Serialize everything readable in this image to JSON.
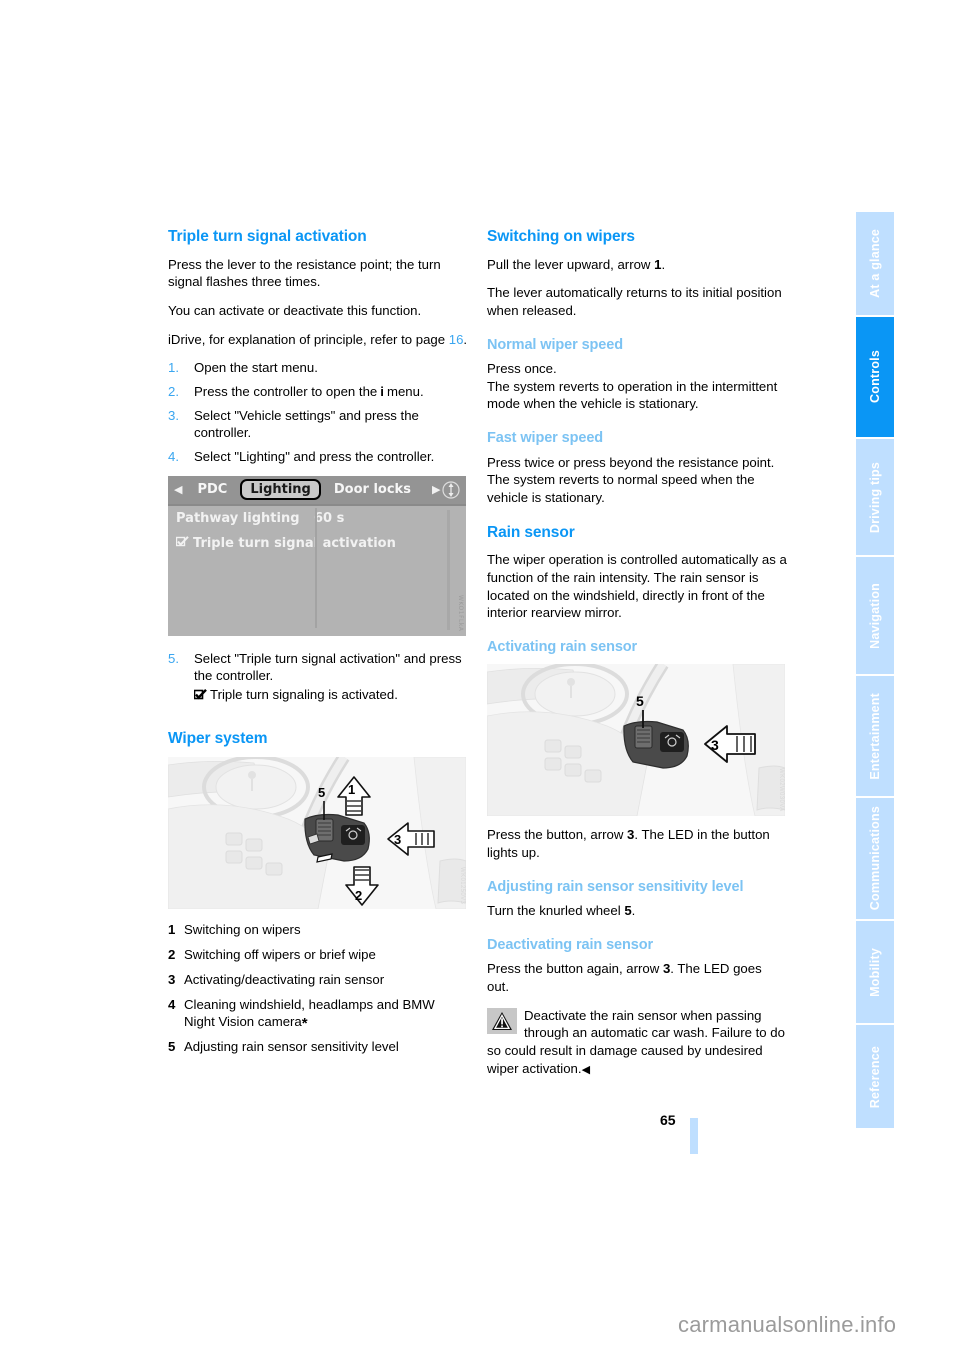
{
  "page": {
    "number": "65",
    "watermark": "carmanualsonline.info"
  },
  "sidebar": {
    "tabs": [
      {
        "label": "At a glance",
        "active": false
      },
      {
        "label": "Controls",
        "active": true
      },
      {
        "label": "Driving tips",
        "active": false
      },
      {
        "label": "Navigation",
        "active": false
      },
      {
        "label": "Entertainment",
        "active": false
      },
      {
        "label": "Communications",
        "active": false
      },
      {
        "label": "Mobility",
        "active": false
      },
      {
        "label": "Reference",
        "active": false
      }
    ],
    "active_color": "#0a96f5",
    "inactive_color": "#bfdfff"
  },
  "colors": {
    "heading": "#0a96f5",
    "subheading": "#7cc3f3",
    "link": "#3aa6f0"
  },
  "left_column": {
    "heading": "Triple turn signal activation",
    "paragraphs": [
      "Press the lever to the resistance point; the turn signal flashes three times.",
      "You can activate or deactivate this function."
    ],
    "idrive_intro_pre": "iDrive, for explanation of principle, refer to page ",
    "idrive_intro_page": "16",
    "idrive_intro_post": ".",
    "steps": [
      {
        "num": "1.",
        "text": "Open the start menu."
      },
      {
        "num": "2.",
        "text": "Press the controller to open the",
        "icon": "i",
        "text_after": "menu."
      },
      {
        "num": "3.",
        "text": "Select \"Vehicle settings\" and press the controller."
      },
      {
        "num": "4.",
        "text": "Select \"Lighting\" and press the controller."
      }
    ],
    "step5": {
      "num": "5.",
      "text": "Select \"Triple turn signal activation\" and press the controller.",
      "result": "Triple turn signaling is activated."
    },
    "idrive_screen": {
      "left_arrow": "◀",
      "right_arrow": "▶",
      "tabs": [
        "PDC",
        "Lighting",
        "Door locks"
      ],
      "selected_tab": "Lighting",
      "rows": [
        {
          "label": "Pathway lighting",
          "value": "60 s"
        },
        {
          "label": "Triple turn signal activation",
          "value": "",
          "checkbox": true
        }
      ],
      "image_id": "WKO1FLkA"
    },
    "wiper_heading": "Wiper system",
    "illustration": {
      "callouts": [
        "1",
        "2",
        "3",
        "5"
      ],
      "image_id": "WK01250V3"
    },
    "legend": [
      {
        "num": "1",
        "text": "Switching on wipers"
      },
      {
        "num": "2",
        "text": "Switching off wipers or brief wipe"
      },
      {
        "num": "3",
        "text": "Activating/deactivating rain sensor"
      },
      {
        "num": "4",
        "text": "Cleaning windshield, headlamps and BMW Night Vision camera",
        "superscript": "*"
      },
      {
        "num": "5",
        "text": "Adjusting rain sensor sensitivity level"
      }
    ]
  },
  "right_column": {
    "sections": [
      {
        "level": "h2",
        "heading": "Switching on wipers",
        "paragraphs": [
          {
            "pre": "Pull the lever upward, arrow ",
            "bold": "1",
            "post": "."
          },
          {
            "pre": "The lever automatically returns to its initial position when released.",
            "bold": "",
            "post": ""
          }
        ]
      },
      {
        "level": "h3",
        "heading": "Normal wiper speed",
        "paragraphs": [
          {
            "pre": "Press once.",
            "bold": "",
            "post": ""
          },
          {
            "pre": "The system reverts to operation in the intermittent mode when the vehicle is stationary.",
            "bold": "",
            "post": ""
          }
        ]
      },
      {
        "level": "h3",
        "heading": "Fast wiper speed",
        "paragraphs": [
          {
            "pre": "Press twice or press beyond the resistance point.",
            "bold": "",
            "post": ""
          },
          {
            "pre": "The system reverts to normal speed when the vehicle is stationary.",
            "bold": "",
            "post": ""
          }
        ]
      },
      {
        "level": "h2",
        "heading": "Rain sensor",
        "paragraphs": [
          {
            "pre": "The wiper operation is controlled automatically as a function of the rain intensity. The rain sensor is located on the windshield, directly in front of the interior rearview mirror.",
            "bold": "",
            "post": ""
          }
        ]
      }
    ],
    "activating_heading": "Activating rain sensor",
    "illustration": {
      "callouts": [
        "3",
        "5"
      ],
      "image_id": "WK02W030VA"
    },
    "activating_text": {
      "pre": "Press the button, arrow ",
      "bold": "3",
      "post": ". The LED in the button lights up."
    },
    "adjusting_heading": "Adjusting rain sensor sensitivity level",
    "adjusting_text": {
      "pre": "Turn the knurled wheel ",
      "bold": "5",
      "post": "."
    },
    "deactivating_heading": "Deactivating rain sensor",
    "deactivating_text": {
      "pre": "Press the button again, arrow ",
      "bold": "3",
      "post": ". The LED goes out."
    },
    "warning": {
      "icon": "warning-triangle-icon",
      "text": "Deactivate the rain sensor when passing through an automatic car wash. Failure to do so could result in damage caused by undesired wiper activation.",
      "endmark": "◀"
    }
  }
}
